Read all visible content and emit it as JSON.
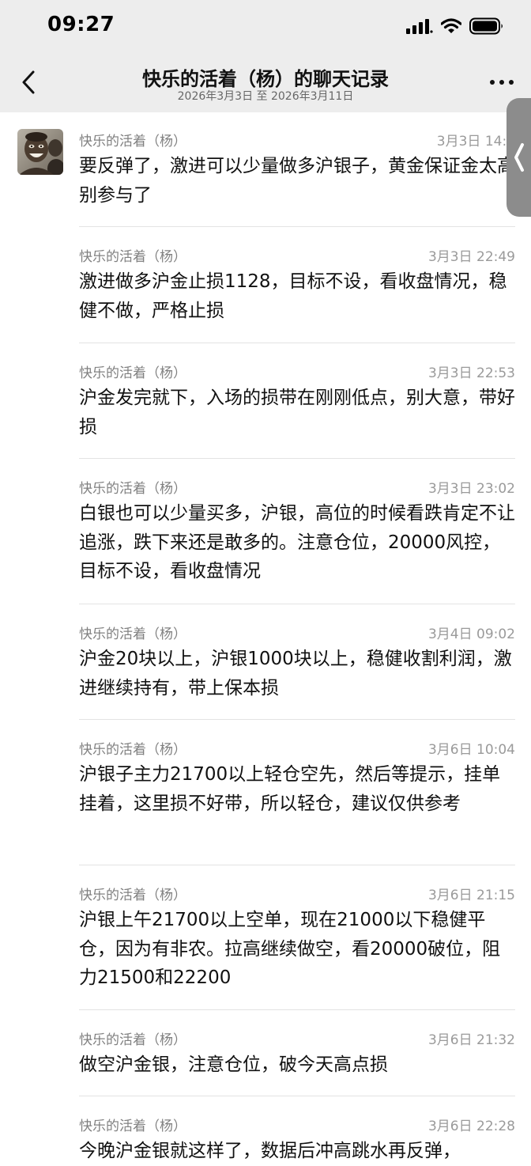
{
  "status_bar": {
    "time": "09:27",
    "icons": [
      "signal-icon",
      "wifi-icon",
      "battery-icon"
    ]
  },
  "nav": {
    "back_icon": "chevron-left-icon",
    "title": "快乐的活着（杨）的聊天记录",
    "subtitle": "2026年3月3日 至 2026年3月11日",
    "more_icon": "more-dots-icon"
  },
  "side_handle_icon": "chevron-left-icon",
  "messages": [
    {
      "sender": "快乐的活着（杨）",
      "time": "3月3日 14:4",
      "text": "要反弹了，激进可以少量做多沪银子，黄金保证金太高别参与了"
    },
    {
      "sender": "快乐的活着（杨）",
      "time": "3月3日 22:49",
      "text": "激进做多沪金止损1128，目标不设，看收盘情况，稳健不做，严格止损"
    },
    {
      "sender": "快乐的活着（杨）",
      "time": "3月3日 22:53",
      "text": "沪金发完就下，入场的损带在刚刚低点，别大意，带好损"
    },
    {
      "sender": "快乐的活着（杨）",
      "time": "3月3日 23:02",
      "text": "白银也可以少量买多，沪银，高位的时候看跌肯定不让追涨，跌下来还是敢多的。注意仓位，20000风控，目标不设，看收盘情况"
    },
    {
      "sender": "快乐的活着（杨）",
      "time": "3月4日 09:02",
      "text": "沪金20块以上，沪银1000块以上，稳健收割利润，激进继续持有，带上保本损"
    },
    {
      "sender": "快乐的活着（杨）",
      "time": "3月6日 10:04",
      "text": "沪银子主力21700以上轻仓空先，然后等提示，挂单挂着，这里损不好带，所以轻仓，建议仅供参考"
    },
    {
      "sender": "快乐的活着（杨）",
      "time": "3月6日 21:15",
      "text": "沪银上午21700以上空单，现在21000以下稳健平仓，因为有非农。拉高继续做空，看20000破位，阻力21500和22200"
    },
    {
      "sender": "快乐的活着（杨）",
      "time": "3月6日 21:32",
      "text": "做空沪金银，注意仓位，破今天高点损"
    },
    {
      "sender": "快乐的活着（杨）",
      "time": "3月6日 22:28",
      "text": "今晚沪金银就这样了，数据后冲高跳水再反弹，"
    }
  ]
}
